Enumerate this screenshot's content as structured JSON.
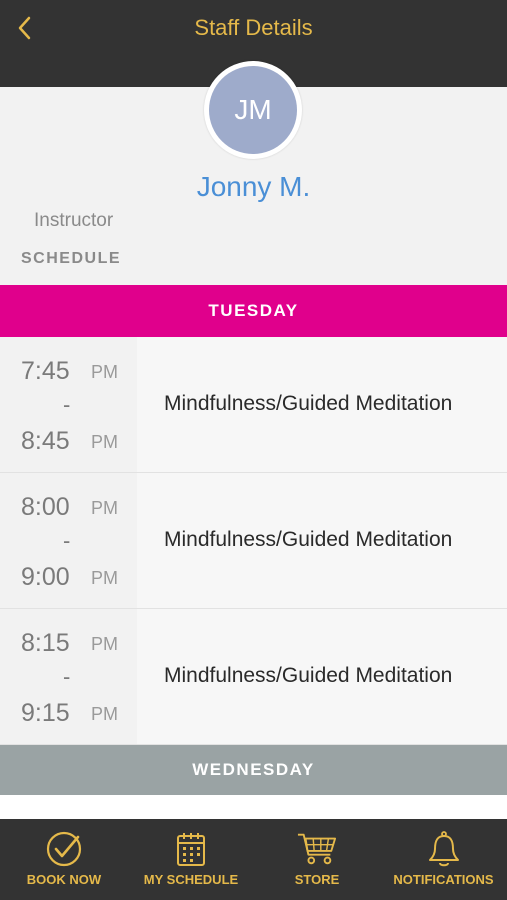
{
  "header": {
    "title": "Staff Details",
    "back_icon": "chevron-left-icon"
  },
  "profile": {
    "initials": "JM",
    "name": "Jonny M.",
    "role": "Instructor",
    "section_label": "SCHEDULE"
  },
  "schedule": {
    "days": [
      {
        "day": "TUESDAY",
        "color": "#e0008c",
        "classes": [
          {
            "start": "7:45",
            "start_ampm": "PM",
            "dash": "-",
            "end": "8:45",
            "end_ampm": "PM",
            "name": "Mindfulness/Guided Meditation"
          },
          {
            "start": "8:00",
            "start_ampm": "PM",
            "dash": "-",
            "end": "9:00",
            "end_ampm": "PM",
            "name": "Mindfulness/Guided Meditation"
          },
          {
            "start": "8:15",
            "start_ampm": "PM",
            "dash": "-",
            "end": "9:15",
            "end_ampm": "PM",
            "name": "Mindfulness/Guided Meditation"
          }
        ]
      },
      {
        "day": "WEDNESDAY",
        "color": "#9aa3a4",
        "classes": []
      }
    ]
  },
  "tabbar": {
    "items": [
      {
        "label": "BOOK NOW",
        "icon": "check-circle-icon"
      },
      {
        "label": "MY SCHEDULE",
        "icon": "calendar-icon"
      },
      {
        "label": "STORE",
        "icon": "cart-icon"
      },
      {
        "label": "NOTIFICATIONS",
        "icon": "bell-icon"
      }
    ]
  },
  "colors": {
    "header_bg": "#333333",
    "accent_gold": "#e5b94a",
    "name_blue": "#4a8fd6",
    "avatar_bg": "#9eabcb"
  }
}
